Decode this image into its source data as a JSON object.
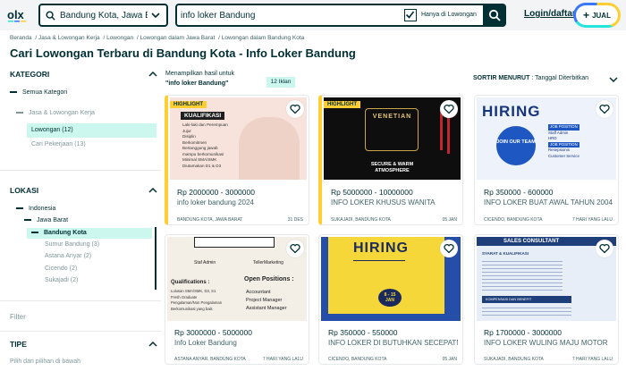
{
  "header": {
    "logo_text": "olx",
    "location_value": "Bandung Kota, Jawa Barat",
    "search_value": "info loker Bandung",
    "only_in_vacancy_label": "Hanya di Lowongan",
    "login_label": "Login/daftar",
    "sell_label": "JUAL"
  },
  "breadcrumb": [
    "Beranda",
    "Jasa & Lowongan Kerja",
    "Lowongan",
    "Lowongan dalam Jawa Barat",
    "Lowongan dalam Bandung Kota"
  ],
  "page_title": "Cari Lowongan Terbaru di Bandung Kota - Info Loker Bandung",
  "sidebar": {
    "kategori_title": "KATEGORI",
    "kategori_items": [
      "Semua Kategori",
      "Jasa & Lowongan Kerja",
      "Lowongan (12)",
      "Cari Pekerjaan (13)"
    ],
    "lokasi_title": "LOKASI",
    "lokasi_items": [
      "Indonesia",
      "Jawa Barat",
      "Bandung Kota",
      "Sumur Bandung (3)",
      "Astana Anyar (2)",
      "Cicendo (2)",
      "Sukajadi (2)"
    ],
    "filter_label": "Filter",
    "tipe_title": "TIPE",
    "tipe_sub": "Pilih dari pilihan di bawah"
  },
  "results": {
    "showing_label": "Menampilkan hasil untuk",
    "query": "\"info loker Bandung\"",
    "count": "12 Iklan",
    "sort_label": "SORTIR MENURUT",
    "sort_value": ": Tanggal Diterbitkan"
  },
  "highlight_label": "HIGHLIGHT",
  "listings": [
    {
      "price": "Rp 2000000 - 3000000",
      "title": "info loker bandung 2024",
      "location": "BANDUNG KOTA, JAWA BARAT",
      "date": "31 DES",
      "img_text": "KUALIFIKASI",
      "img_lines": [
        "Laki-laki dan Perempuan",
        "Jujur",
        "Disiplin",
        "Berkomitmen",
        "Bertanggung jawab",
        "mampu berkomunikasi",
        "Minimal SMA/SMK",
        "Diutamakan D1 & D3"
      ]
    },
    {
      "price": "Rp 5000000 - 10000000",
      "title": "INFO LOKER KHUSUS WANITA",
      "location": "SUKAJADI, BANDUNG KOTA",
      "date": "05 JAN",
      "img_text": "VENETIAN",
      "img_lines": [
        "SECURE & WARM",
        "ATMOSPHERE"
      ]
    },
    {
      "price": "Rp 350000 - 600000",
      "title": "INFO LOKER BUAT AWAL TAHUN 2004",
      "location": "CICENDO, BANDUNG KOTA",
      "date": "7 HARI YANG LALU",
      "img_text": "HIRING",
      "img_lines": [
        "JOIN OUR TEAM",
        "JOB POSITION",
        "Staff Admin",
        "HRD",
        "JOB POSITION",
        "Resepsionis",
        "Customer Service"
      ]
    },
    {
      "price": "Rp 3000000 - 5000000",
      "title": "Info Loker Bandung",
      "location": "ASTANA ANYAR, BANDUNG KOTA",
      "date": "7 HARI YANG LALU",
      "img_text": "Open Positions :",
      "img_lines": [
        "Staf Admin",
        "TellerMarketing",
        "Qualifications :",
        "Lulusan SMA/SMK, D3, S1",
        "Fresh Graduate",
        "Pengalaman/Non Pengalaman",
        "Berkomunikasi yang baik",
        "Accountant",
        "Project Manager",
        "Assistant Manager"
      ]
    },
    {
      "price": "Rp 350000 - 550000",
      "title": "INFO LOKER DI BUTUHKAN SECEPATNYA",
      "location": "CICENDO, BANDUNG KOTA",
      "date": "05 JAN",
      "img_text": "HIRING",
      "img_lines": [
        "8 - 15",
        "JAN"
      ]
    },
    {
      "price": "Rp 1700000 - 3000000",
      "title": "INFO LOKER WULING MAJU MOTOR",
      "location": "SUKAJADI, BANDUNG KOTA",
      "date": "7 HARI YANG LALU",
      "img_text": "SALES CONSULTANT",
      "img_lines": [
        "SYARAT & KUALIFIKASI",
        "KOMPENSASI DAN BENEFIT"
      ]
    }
  ],
  "colors": {
    "brand_dark": "#002f34",
    "highlight": "#ffce32",
    "selected_bg": "#cbf7ee"
  }
}
